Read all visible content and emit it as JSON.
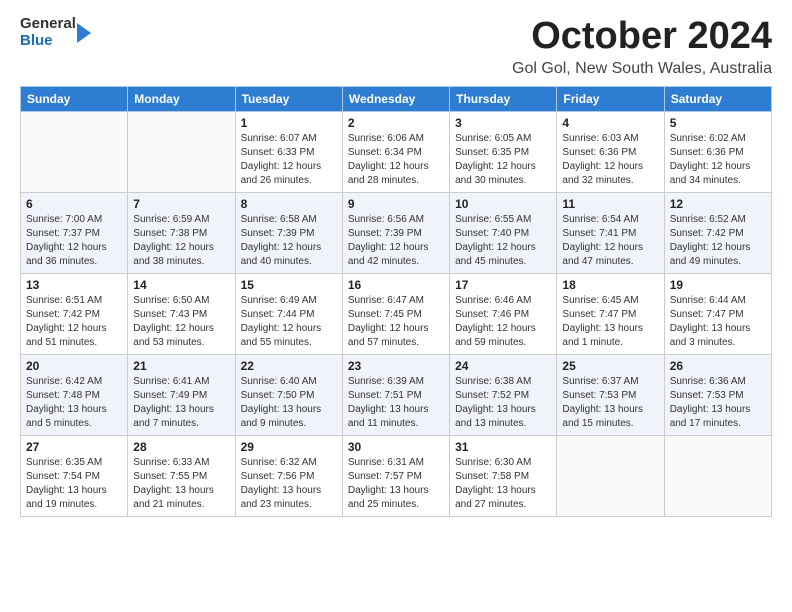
{
  "logo": {
    "general": "General",
    "blue": "Blue"
  },
  "title": "October 2024",
  "location": "Gol Gol, New South Wales, Australia",
  "headers": [
    "Sunday",
    "Monday",
    "Tuesday",
    "Wednesday",
    "Thursday",
    "Friday",
    "Saturday"
  ],
  "weeks": [
    [
      {
        "day": "",
        "info": ""
      },
      {
        "day": "",
        "info": ""
      },
      {
        "day": "1",
        "info": "Sunrise: 6:07 AM\nSunset: 6:33 PM\nDaylight: 12 hours\nand 26 minutes."
      },
      {
        "day": "2",
        "info": "Sunrise: 6:06 AM\nSunset: 6:34 PM\nDaylight: 12 hours\nand 28 minutes."
      },
      {
        "day": "3",
        "info": "Sunrise: 6:05 AM\nSunset: 6:35 PM\nDaylight: 12 hours\nand 30 minutes."
      },
      {
        "day": "4",
        "info": "Sunrise: 6:03 AM\nSunset: 6:36 PM\nDaylight: 12 hours\nand 32 minutes."
      },
      {
        "day": "5",
        "info": "Sunrise: 6:02 AM\nSunset: 6:36 PM\nDaylight: 12 hours\nand 34 minutes."
      }
    ],
    [
      {
        "day": "6",
        "info": "Sunrise: 7:00 AM\nSunset: 7:37 PM\nDaylight: 12 hours\nand 36 minutes."
      },
      {
        "day": "7",
        "info": "Sunrise: 6:59 AM\nSunset: 7:38 PM\nDaylight: 12 hours\nand 38 minutes."
      },
      {
        "day": "8",
        "info": "Sunrise: 6:58 AM\nSunset: 7:39 PM\nDaylight: 12 hours\nand 40 minutes."
      },
      {
        "day": "9",
        "info": "Sunrise: 6:56 AM\nSunset: 7:39 PM\nDaylight: 12 hours\nand 42 minutes."
      },
      {
        "day": "10",
        "info": "Sunrise: 6:55 AM\nSunset: 7:40 PM\nDaylight: 12 hours\nand 45 minutes."
      },
      {
        "day": "11",
        "info": "Sunrise: 6:54 AM\nSunset: 7:41 PM\nDaylight: 12 hours\nand 47 minutes."
      },
      {
        "day": "12",
        "info": "Sunrise: 6:52 AM\nSunset: 7:42 PM\nDaylight: 12 hours\nand 49 minutes."
      }
    ],
    [
      {
        "day": "13",
        "info": "Sunrise: 6:51 AM\nSunset: 7:42 PM\nDaylight: 12 hours\nand 51 minutes."
      },
      {
        "day": "14",
        "info": "Sunrise: 6:50 AM\nSunset: 7:43 PM\nDaylight: 12 hours\nand 53 minutes."
      },
      {
        "day": "15",
        "info": "Sunrise: 6:49 AM\nSunset: 7:44 PM\nDaylight: 12 hours\nand 55 minutes."
      },
      {
        "day": "16",
        "info": "Sunrise: 6:47 AM\nSunset: 7:45 PM\nDaylight: 12 hours\nand 57 minutes."
      },
      {
        "day": "17",
        "info": "Sunrise: 6:46 AM\nSunset: 7:46 PM\nDaylight: 12 hours\nand 59 minutes."
      },
      {
        "day": "18",
        "info": "Sunrise: 6:45 AM\nSunset: 7:47 PM\nDaylight: 13 hours\nand 1 minute."
      },
      {
        "day": "19",
        "info": "Sunrise: 6:44 AM\nSunset: 7:47 PM\nDaylight: 13 hours\nand 3 minutes."
      }
    ],
    [
      {
        "day": "20",
        "info": "Sunrise: 6:42 AM\nSunset: 7:48 PM\nDaylight: 13 hours\nand 5 minutes."
      },
      {
        "day": "21",
        "info": "Sunrise: 6:41 AM\nSunset: 7:49 PM\nDaylight: 13 hours\nand 7 minutes."
      },
      {
        "day": "22",
        "info": "Sunrise: 6:40 AM\nSunset: 7:50 PM\nDaylight: 13 hours\nand 9 minutes."
      },
      {
        "day": "23",
        "info": "Sunrise: 6:39 AM\nSunset: 7:51 PM\nDaylight: 13 hours\nand 11 minutes."
      },
      {
        "day": "24",
        "info": "Sunrise: 6:38 AM\nSunset: 7:52 PM\nDaylight: 13 hours\nand 13 minutes."
      },
      {
        "day": "25",
        "info": "Sunrise: 6:37 AM\nSunset: 7:53 PM\nDaylight: 13 hours\nand 15 minutes."
      },
      {
        "day": "26",
        "info": "Sunrise: 6:36 AM\nSunset: 7:53 PM\nDaylight: 13 hours\nand 17 minutes."
      }
    ],
    [
      {
        "day": "27",
        "info": "Sunrise: 6:35 AM\nSunset: 7:54 PM\nDaylight: 13 hours\nand 19 minutes."
      },
      {
        "day": "28",
        "info": "Sunrise: 6:33 AM\nSunset: 7:55 PM\nDaylight: 13 hours\nand 21 minutes."
      },
      {
        "day": "29",
        "info": "Sunrise: 6:32 AM\nSunset: 7:56 PM\nDaylight: 13 hours\nand 23 minutes."
      },
      {
        "day": "30",
        "info": "Sunrise: 6:31 AM\nSunset: 7:57 PM\nDaylight: 13 hours\nand 25 minutes."
      },
      {
        "day": "31",
        "info": "Sunrise: 6:30 AM\nSunset: 7:58 PM\nDaylight: 13 hours\nand 27 minutes."
      },
      {
        "day": "",
        "info": ""
      },
      {
        "day": "",
        "info": ""
      }
    ]
  ]
}
